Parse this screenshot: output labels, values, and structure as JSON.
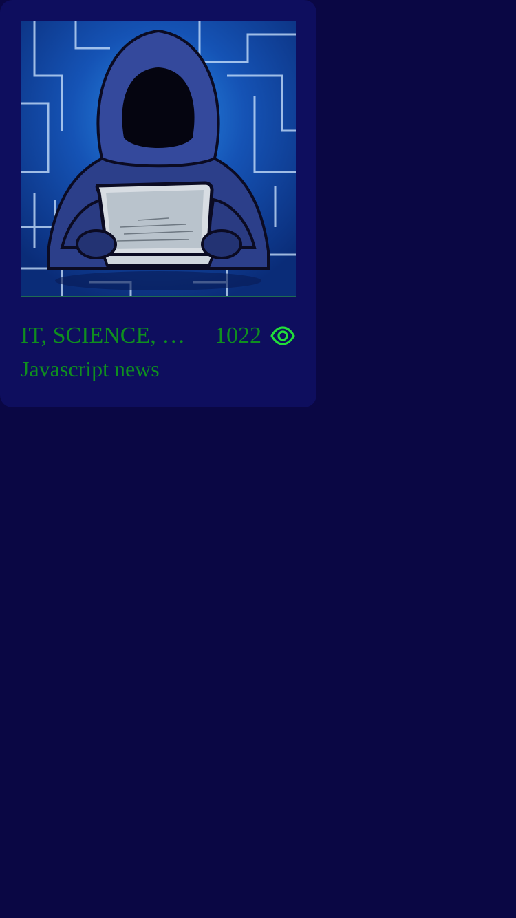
{
  "card": {
    "image_alt": "hooded hacker with laptop",
    "category": "IT, SCIENCE, PROGRAMMING",
    "views": "1022",
    "title": "Javascript news",
    "eye_icon": "eye-icon"
  },
  "colors": {
    "page_background": "#0a0744",
    "card_background": "#0e0e5e",
    "text_green": "#0f8f1f",
    "icon_green": "#22dd3a"
  }
}
